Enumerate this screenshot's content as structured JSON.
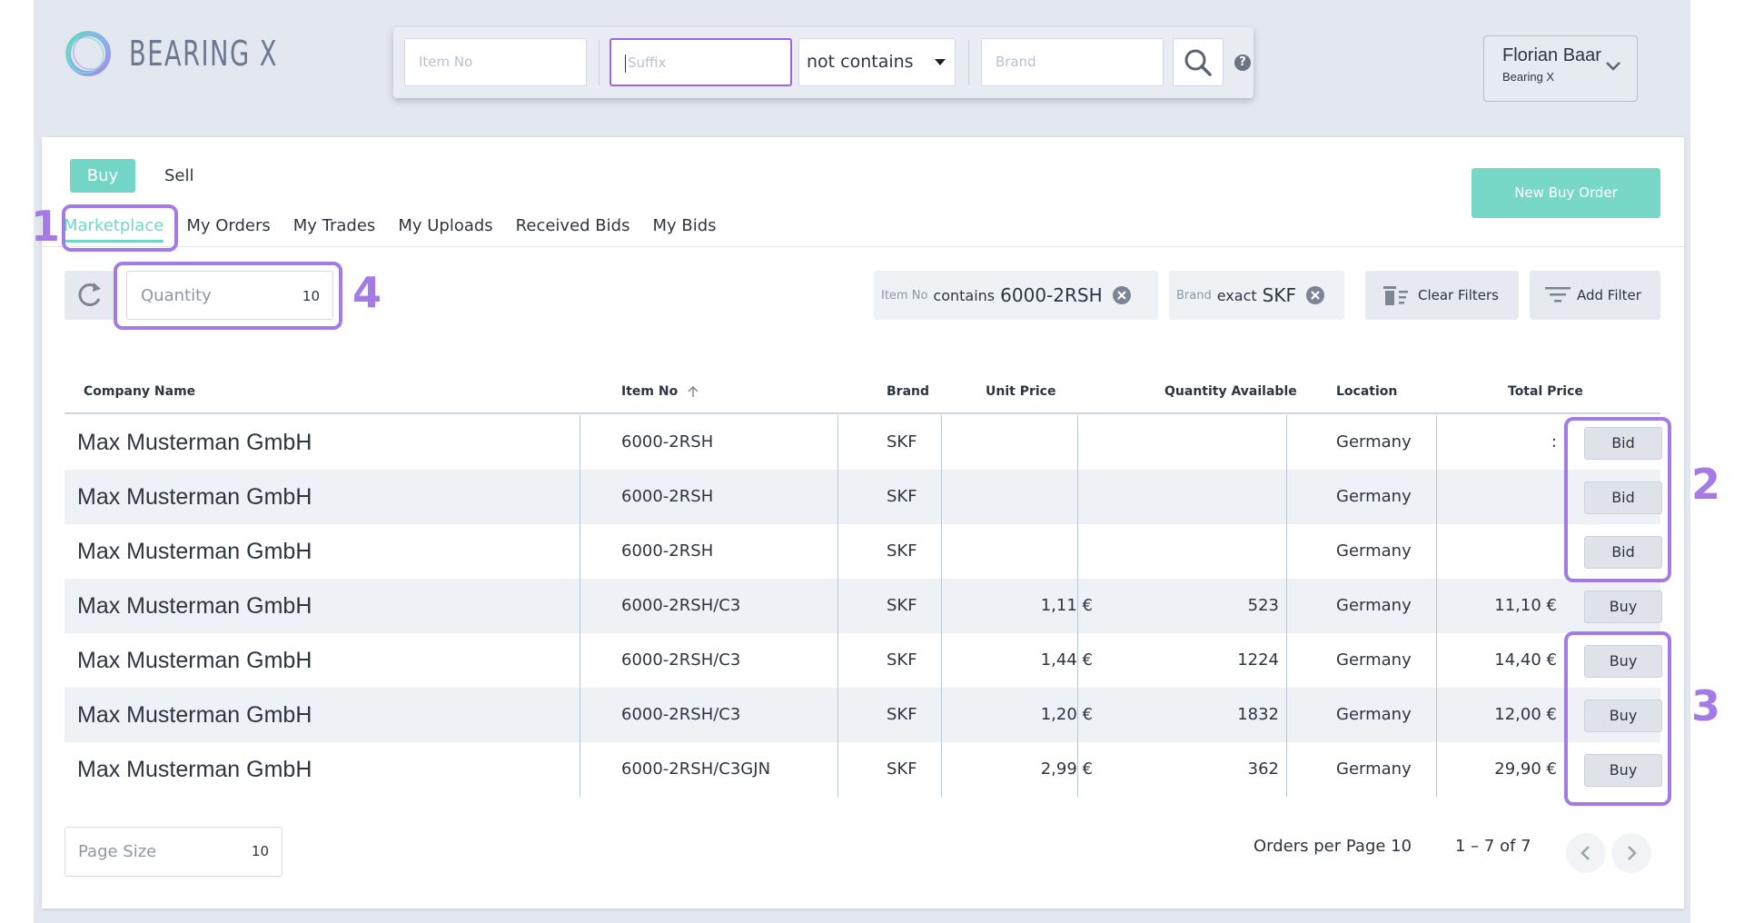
{
  "brand": {
    "logo_text": "BEARING X"
  },
  "search": {
    "item_no_placeholder": "Item No",
    "suffix_placeholder": "Suffix",
    "operator_value": "not contains",
    "brand_placeholder": "Brand",
    "help_glyph": "?"
  },
  "user": {
    "name": "Florian Baar",
    "company": "Bearing X"
  },
  "mode": {
    "buy": "Buy",
    "sell": "Sell"
  },
  "new_buy_order_label": "New Buy Order",
  "tabs": [
    {
      "label": "Marketplace",
      "active": true
    },
    {
      "label": "My Orders"
    },
    {
      "label": "My Trades"
    },
    {
      "label": "My Uploads"
    },
    {
      "label": "Received Bids"
    },
    {
      "label": "My Bids"
    }
  ],
  "toolbar": {
    "quantity_label": "Quantity",
    "quantity_value": "10",
    "clear_filters_label": "Clear Filters",
    "add_filter_label": "Add Filter"
  },
  "filters": [
    {
      "field": "Item No",
      "operator": "contains",
      "value": "6000-2RSH"
    },
    {
      "field": "Brand",
      "operator": "exact",
      "value": "SKF"
    }
  ],
  "table": {
    "headers": {
      "company": "Company Name",
      "item_no": "Item No",
      "brand": "Brand",
      "unit_price": "Unit Price",
      "quantity": "Quantity Available",
      "location": "Location",
      "total": "Total Price"
    },
    "rows": [
      {
        "company": "Max Musterman GmbH",
        "item_no": "6000-2RSH",
        "brand": "SKF",
        "unit_price": "",
        "quantity": "",
        "location": "Germany",
        "total": ":",
        "action": "Bid"
      },
      {
        "company": "Max Musterman GmbH",
        "item_no": "6000-2RSH",
        "brand": "SKF",
        "unit_price": "",
        "quantity": "",
        "location": "Germany",
        "total": "",
        "action": "Bid"
      },
      {
        "company": "Max Musterman GmbH",
        "item_no": "6000-2RSH",
        "brand": "SKF",
        "unit_price": "",
        "quantity": "",
        "location": "Germany",
        "total": "",
        "action": "Bid"
      },
      {
        "company": "Max Musterman GmbH",
        "item_no": "6000-2RSH/C3",
        "brand": "SKF",
        "unit_price": "1,11 €",
        "quantity": "523",
        "location": "Germany",
        "total": "11,10 €",
        "action": "Buy"
      },
      {
        "company": "Max Musterman GmbH",
        "item_no": "6000-2RSH/C3",
        "brand": "SKF",
        "unit_price": "1,44 €",
        "quantity": "1224",
        "location": "Germany",
        "total": "14,40 €",
        "action": "Buy"
      },
      {
        "company": "Max Musterman GmbH",
        "item_no": "6000-2RSH/C3",
        "brand": "SKF",
        "unit_price": "1,20 €",
        "quantity": "1832",
        "location": "Germany",
        "total": "12,00 €",
        "action": "Buy"
      },
      {
        "company": "Max Musterman GmbH",
        "item_no": "6000-2RSH/C3GJN",
        "brand": "SKF",
        "unit_price": "2,99 €",
        "quantity": "362",
        "location": "Germany",
        "total": "29,90 €",
        "action": "Buy"
      }
    ]
  },
  "footer": {
    "page_size_label": "Page Size",
    "page_size_value": "10",
    "orders_per_page": "Orders per Page 10",
    "range": "1 – 7 of 7"
  },
  "annotations": [
    "1",
    "2",
    "3",
    "4"
  ],
  "colors": {
    "accent_teal": "#72d5c6",
    "annotation_purple": "#a47be6"
  },
  "icons": [
    "search-icon",
    "help-icon",
    "chevron-down-icon",
    "refresh-icon",
    "clear-circle-icon",
    "trash-filter-icon",
    "filter-lines-icon",
    "sort-arrow-up-icon",
    "chevron-left-icon",
    "chevron-right-icon"
  ]
}
